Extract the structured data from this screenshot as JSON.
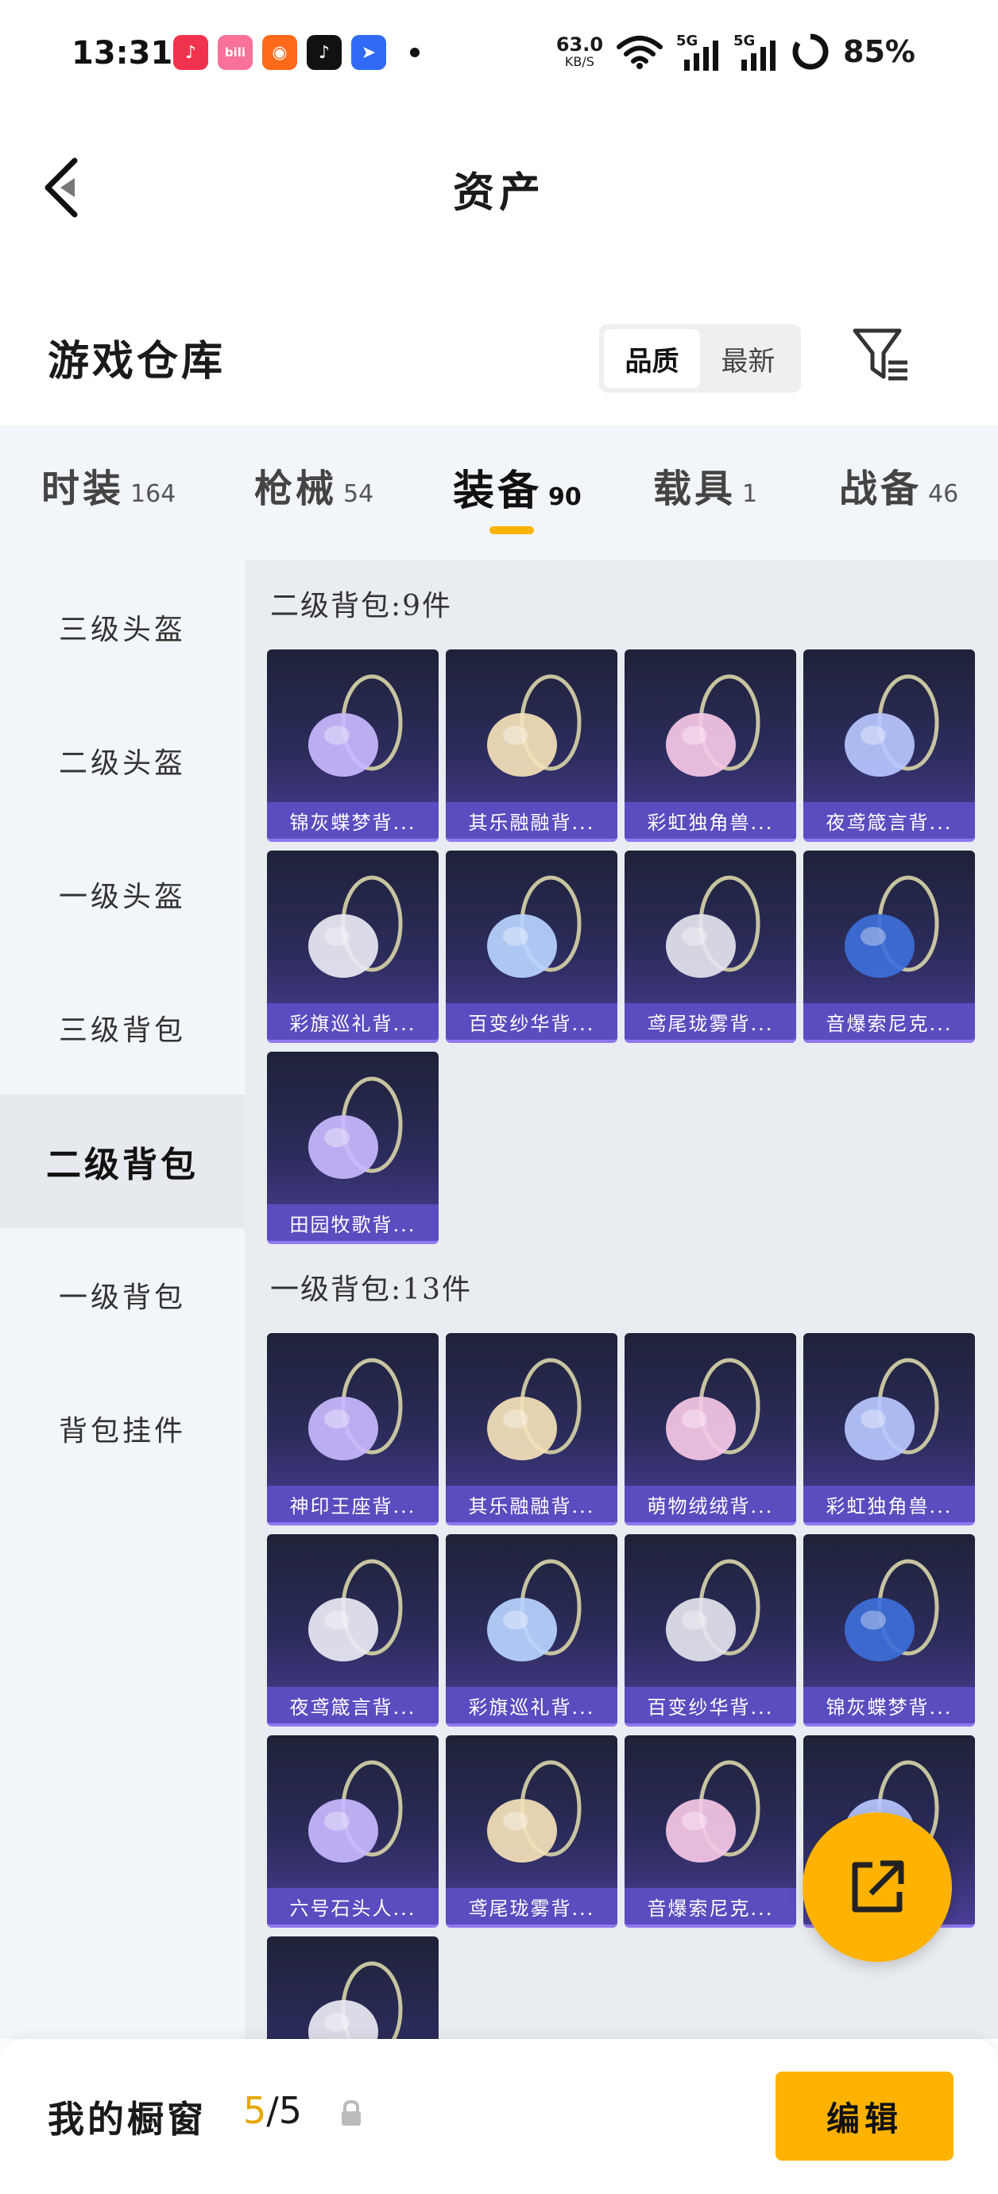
{
  "status_bar": {
    "time": "13:31",
    "net_speed_value": "63.0",
    "net_speed_unit": "KB/S",
    "signal_1": "5G",
    "signal_2": "5G",
    "battery": "85%",
    "apps": [
      "music-app-icon",
      "bilibili-app-icon",
      "kuaishou-app-icon",
      "tiktok-app-icon",
      "feishu-app-icon"
    ]
  },
  "header": {
    "title": "资产"
  },
  "warehouse": {
    "title": "游戏仓库",
    "sort_options": [
      "品质",
      "最新"
    ],
    "sort_active": "品质"
  },
  "tabs": [
    {
      "label": "时装",
      "count": "164"
    },
    {
      "label": "枪械",
      "count": "54"
    },
    {
      "label": "装备",
      "count": "90",
      "active": true
    },
    {
      "label": "载具",
      "count": "1"
    },
    {
      "label": "战备",
      "count": "46"
    }
  ],
  "sidebar": [
    {
      "label": "三级头盔"
    },
    {
      "label": "二级头盔"
    },
    {
      "label": "一级头盔"
    },
    {
      "label": "三级背包"
    },
    {
      "label": "二级背包",
      "active": true
    },
    {
      "label": "一级背包"
    },
    {
      "label": "背包挂件"
    }
  ],
  "sections": [
    {
      "title": "二级背包:9件",
      "items": [
        {
          "name": "锦灰蝶梦背...",
          "icon": "butterfly-dream-backpack"
        },
        {
          "name": "其乐融融背...",
          "icon": "cupcake-backpack"
        },
        {
          "name": "彩虹独角兽...",
          "icon": "unicorn-backpack"
        },
        {
          "name": "夜鸢箴言背...",
          "icon": "night-kite-backpack"
        },
        {
          "name": "彩旗巡礼背...",
          "icon": "flag-parade-backpack"
        },
        {
          "name": "百变纱华背...",
          "icon": "gauze-backpack"
        },
        {
          "name": "鸢尾珑雾背...",
          "icon": "iris-mist-backpack"
        },
        {
          "name": "音爆索尼克...",
          "icon": "sonic-backpack"
        },
        {
          "name": "田园牧歌背...",
          "icon": "picnic-basket-backpack"
        }
      ]
    },
    {
      "title": "一级背包:13件",
      "items": [
        {
          "name": "神印王座背...",
          "icon": "throne-backpack"
        },
        {
          "name": "其乐融融背...",
          "icon": "cupcake-backpack"
        },
        {
          "name": "萌物绒绒背...",
          "icon": "plush-backpack"
        },
        {
          "name": "彩虹独角兽...",
          "icon": "unicorn-backpack"
        },
        {
          "name": "夜鸢箴言背...",
          "icon": "night-kite-backpack"
        },
        {
          "name": "彩旗巡礼背...",
          "icon": "flag-parade-backpack"
        },
        {
          "name": "百变纱华背...",
          "icon": "gauze-backpack"
        },
        {
          "name": "锦灰蝶梦背...",
          "icon": "butterfly-dream-backpack"
        },
        {
          "name": "六号石头人...",
          "icon": "stone-golem-backpack"
        },
        {
          "name": "鸢尾珑雾背...",
          "icon": "iris-mist-backpack"
        },
        {
          "name": "音爆索尼克...",
          "icon": "sonic-backpack"
        },
        {
          "name": "",
          "icon": "hidden-backpack"
        },
        {
          "name": "",
          "icon": "butterfly-wings-backpack"
        }
      ]
    }
  ],
  "showcase": {
    "label": "我的橱窗",
    "current": "5",
    "total": "/5"
  },
  "edit_label": "编辑",
  "colors": {
    "accent": "#ffb300",
    "card_label": "#5b4cc0",
    "card_top": "#1e2238",
    "sidebar_bg": "#f2f5f9"
  }
}
